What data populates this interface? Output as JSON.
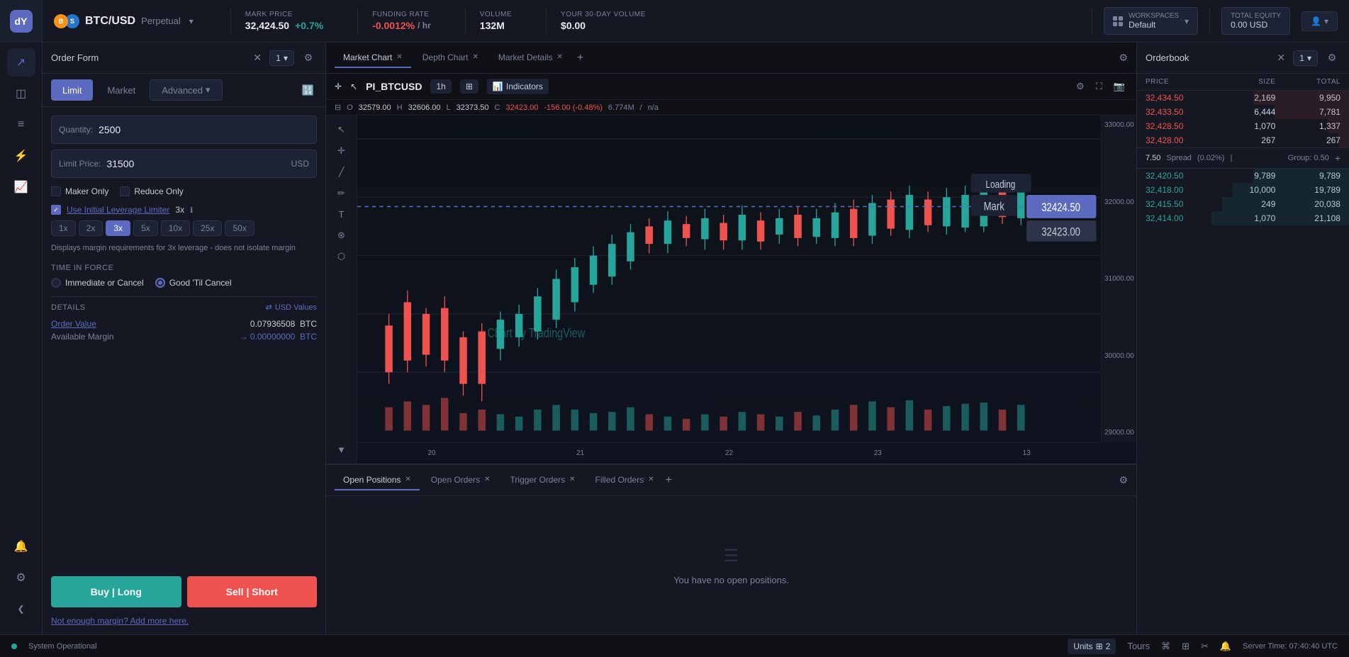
{
  "app": {
    "logo": "dydx"
  },
  "topbar": {
    "pair": "BTC/USD",
    "pair_type": "Perpetual",
    "mark_price_label": "MARK PRICE",
    "mark_price": "32,424.50",
    "mark_change": "+0.7%",
    "funding_label": "FUNDING RATE",
    "funding": "-0.0012%",
    "funding_per": "/ hr",
    "volume_label": "VOLUME",
    "volume": "132M",
    "your_volume_label": "YOUR 30-DAY VOLUME",
    "your_volume": "$0.00",
    "workspace_label": "WORKSPACES",
    "workspace_default": "Default",
    "equity_label": "TOTAL EQUITY",
    "equity_value": "0.00 USD"
  },
  "order_form": {
    "title": "Order Form",
    "quantity_label": "Quantity:",
    "quantity_value": "2500",
    "limit_price_label": "Limit Price:",
    "limit_price_value": "31500",
    "limit_price_suffix": "USD",
    "maker_only_label": "Maker Only",
    "reduce_only_label": "Reduce Only",
    "use_leverage_label": "Use Initial Leverage Limiter",
    "leverage_mult": "3x",
    "lev_options": [
      "1x",
      "2x",
      "3x",
      "5x",
      "10x",
      "25x",
      "50x"
    ],
    "lev_active": "3x",
    "leverage_hint": "Displays margin requirements for 3x leverage - does not isolate margin",
    "tif_title": "TIME IN FORCE",
    "tif_ioc": "Immediate or Cancel",
    "tif_gtc": "Good 'Til Cancel",
    "tif_active": "gtc",
    "details_title": "DETAILS",
    "usd_values": "USD Values",
    "order_value_label": "Order Value",
    "order_value": "0.07936508",
    "order_value_suffix": "BTC",
    "available_margin_label": "Available Margin",
    "available_margin_arrow": "→",
    "available_margin": "0.00000000",
    "available_margin_suffix": "BTC",
    "buy_label": "Buy | Long",
    "sell_label": "Sell | Short",
    "margin_link": "Not enough margin? Add more here.",
    "tabs": {
      "limit": "Limit",
      "market": "Market",
      "advanced": "Advanced"
    }
  },
  "chart": {
    "tabs": [
      {
        "label": "Market Chart",
        "active": true
      },
      {
        "label": "Depth Chart",
        "active": false
      },
      {
        "label": "Market Details",
        "active": false
      }
    ],
    "symbol": "PI_BTCUSD",
    "interval": "1h",
    "indicators_label": "Indicators",
    "ohlc": {
      "o": "32579.00",
      "h": "32606.00",
      "l": "32373.50",
      "c": "32423.00",
      "change": "-156.00 (-0.48%)",
      "volume": "6.774M",
      "volume2": "n/a"
    },
    "price_labels": [
      "33000.00",
      "32000.00",
      "31000.00",
      "30000.00",
      "29000.00"
    ],
    "mark_overlay": "Mark",
    "loading": "Loading",
    "current_price": "32424.50",
    "mark_price": "32423.00",
    "date_labels": [
      "20",
      "21",
      "22",
      "23",
      "13"
    ]
  },
  "orderbook": {
    "title": "Orderbook",
    "cols": {
      "price": "PRICE",
      "size": "SIZE",
      "total": "TOTAL"
    },
    "asks": [
      {
        "price": "32,434.50",
        "size": "2,169",
        "total": "9,950",
        "bar_pct": 45
      },
      {
        "price": "32,433.50",
        "size": "6,444",
        "total": "7,781",
        "bar_pct": 35
      },
      {
        "price": "32,428.50",
        "size": "1,070",
        "total": "1,337",
        "bar_pct": 10
      },
      {
        "price": "32,428.00",
        "size": "267",
        "total": "267",
        "bar_pct": 5
      }
    ],
    "spread": "7.50",
    "spread_pct": "(0.02%)",
    "group_label": "Group: 0.50",
    "bids": [
      {
        "price": "32,420.50",
        "size": "9,789",
        "total": "9,789",
        "bar_pct": 45
      },
      {
        "price": "32,418.00",
        "size": "10,000",
        "total": "19,789",
        "bar_pct": 55
      },
      {
        "price": "32,415.50",
        "size": "249",
        "total": "20,038",
        "bar_pct": 60
      },
      {
        "price": "32,414.00",
        "size": "1,070",
        "total": "21,108",
        "bar_pct": 65
      }
    ]
  },
  "bottom_panel": {
    "tabs": [
      {
        "label": "Open Positions",
        "active": true
      },
      {
        "label": "Open Orders",
        "active": false
      },
      {
        "label": "Trigger Orders",
        "active": false
      },
      {
        "label": "Filled Orders",
        "active": false
      }
    ],
    "empty_text": "You have no open positions."
  },
  "status_bar": {
    "status": "System Operational",
    "units": "Units",
    "units_num": "2",
    "tours": "Tours",
    "server_time": "Server Time: 07:40:40 UTC"
  },
  "nav": {
    "icons": [
      {
        "name": "logo",
        "symbol": "dY"
      },
      {
        "name": "trade",
        "symbol": "↗"
      },
      {
        "name": "portfolio",
        "symbol": "◫"
      },
      {
        "name": "orders",
        "symbol": "≡"
      },
      {
        "name": "alerts",
        "symbol": "⚡"
      },
      {
        "name": "analytics",
        "symbol": "📈"
      },
      {
        "name": "notifications",
        "symbol": "🔔"
      },
      {
        "name": "settings",
        "symbol": "⚙"
      }
    ]
  }
}
